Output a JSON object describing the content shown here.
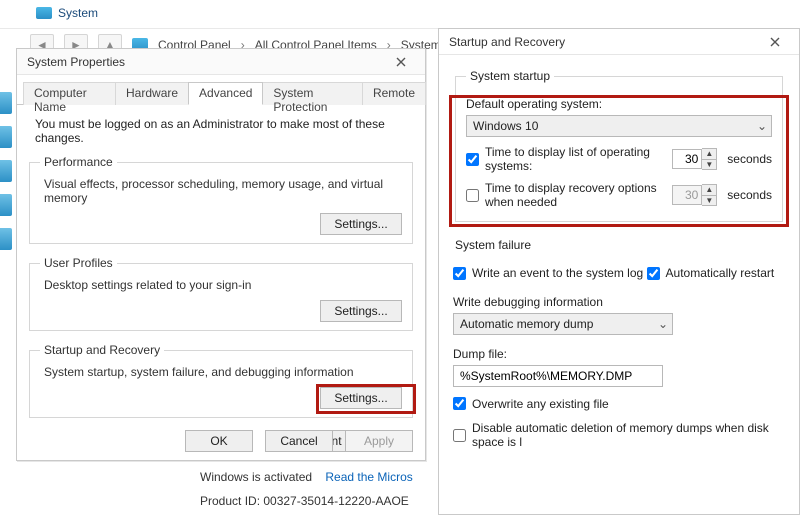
{
  "bg": {
    "title": "System",
    "crumbs": [
      "Control Panel",
      "All Control Panel Items",
      "System"
    ]
  },
  "sysprops": {
    "title": "System Properties",
    "tabs": [
      "Computer Name",
      "Hardware",
      "Advanced",
      "System Protection",
      "Remote"
    ],
    "active_tab": 2,
    "admin_note": "You must be logged on as an Administrator to make most of these changes.",
    "groups": {
      "performance": {
        "title": "Performance",
        "desc": "Visual effects, processor scheduling, memory usage, and virtual memory",
        "button": "Settings..."
      },
      "user_profiles": {
        "title": "User Profiles",
        "desc": "Desktop settings related to your sign-in",
        "button": "Settings..."
      },
      "startup_recovery": {
        "title": "Startup and Recovery",
        "desc": "System startup, system failure, and debugging information",
        "button": "Settings..."
      }
    },
    "env_button": "Environment Variables...",
    "buttons": {
      "ok": "OK",
      "cancel": "Cancel",
      "apply": "Apply"
    }
  },
  "activation": {
    "status": "Windows is activated",
    "link": "Read the Micros",
    "product_id": "Product ID: 00327-35014-12220-AAOE"
  },
  "startrec": {
    "title": "Startup and Recovery",
    "system_startup_legend": "System startup",
    "default_os_label": "Default operating system:",
    "default_os_value": "Windows 10",
    "time_list": {
      "checked": true,
      "label": "Time to display list of operating systems:",
      "value": "30",
      "unit": "seconds"
    },
    "time_recovery": {
      "checked": false,
      "label": "Time to display recovery options when needed",
      "value": "30",
      "unit": "seconds"
    },
    "system_failure_title": "System failure",
    "write_event": {
      "checked": true,
      "label": "Write an event to the system log"
    },
    "auto_restart": {
      "checked": true,
      "label": "Automatically restart"
    },
    "debug_info_label": "Write debugging information",
    "debug_info_value": "Automatic memory dump",
    "dump_file_label": "Dump file:",
    "dump_file_value": "%SystemRoot%\\MEMORY.DMP",
    "overwrite": {
      "checked": true,
      "label": "Overwrite any existing file"
    },
    "disable_autodel": {
      "checked": false,
      "label": "Disable automatic deletion of memory dumps when disk space is l"
    }
  }
}
